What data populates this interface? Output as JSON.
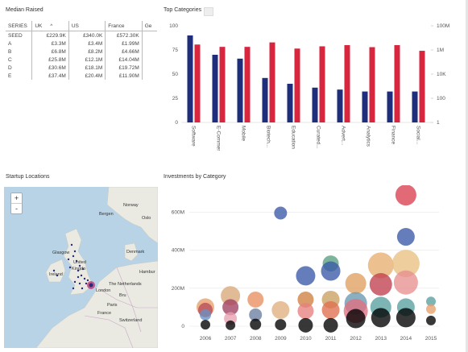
{
  "median": {
    "title": "Median Raised",
    "columns": [
      "SERIES",
      "UK",
      "US",
      "France",
      "Ge"
    ],
    "rows": [
      {
        "series": "SEED",
        "uk": "£229.9K",
        "us": "£340.0K",
        "france": "£572.30K"
      },
      {
        "series": "A",
        "uk": "£3.3M",
        "us": "£3.4M",
        "france": "£1.99M"
      },
      {
        "series": "B",
        "uk": "£6.8M",
        "us": "£8.2M",
        "france": "£4.66M"
      },
      {
        "series": "C",
        "uk": "£25.8M",
        "us": "£12.1M",
        "france": "£14.04M"
      },
      {
        "series": "D",
        "uk": "£30.6M",
        "us": "£18.1M",
        "france": "£19.72M"
      },
      {
        "series": "E",
        "uk": "£37.4M",
        "us": "£20.4M",
        "france": "£11.90M"
      }
    ],
    "sort_icon": "chevron-up-icon"
  },
  "top_categories": {
    "title": "Top Categories",
    "chart_data": {
      "type": "bar",
      "categories": [
        "Software",
        "E-Commerce",
        "Mobile",
        "Biotech...",
        "Education",
        "Curated...",
        "Advert...",
        "Analytics",
        "Finance",
        "Social..."
      ],
      "series": [
        {
          "values": [
            90,
            70,
            66,
            46,
            40,
            36,
            34,
            32,
            32,
            32
          ],
          "axis": "left",
          "color": "#1f2e7a"
        },
        {
          "values": [
            2800000,
            1800000,
            1800000,
            4200000,
            1300000,
            2000000,
            2500000,
            1700000,
            2500000,
            850000
          ],
          "axis": "right",
          "color": "#d7263d"
        }
      ],
      "y_left": {
        "ticks": [
          "0",
          "25",
          "50",
          "75",
          "100"
        ],
        "ylim": [
          0,
          100
        ]
      },
      "y_right": {
        "ticks": [
          "1",
          "100",
          "10K",
          "1M",
          "100M"
        ],
        "scale": "log",
        "ylim": [
          1,
          100000000
        ]
      }
    }
  },
  "map": {
    "title": "Startup Locations",
    "zoom_in": "+",
    "zoom_out": "-",
    "labels": [
      "Norway",
      "Oslo",
      "Bergen",
      "Glasgow",
      "Denmark",
      "United",
      "Kingdo",
      "Ireland",
      "Hambur",
      "The Netherlands",
      "London",
      "Bru",
      "Paris",
      "France",
      "Switzerland"
    ]
  },
  "investments": {
    "title": "Investments by Category",
    "chart_data": {
      "type": "scatter",
      "x_ticks": [
        "2006",
        "2007",
        "2008",
        "2009",
        "2010",
        "2011",
        "2012",
        "2013",
        "2014",
        "2015"
      ],
      "y_ticks": [
        "0",
        "200M",
        "400M",
        "600M"
      ],
      "ylim": [
        0,
        720000000
      ],
      "points": [
        {
          "x": 2006,
          "y": 100000000,
          "r": 11,
          "color": "#e8a06a"
        },
        {
          "x": 2006,
          "y": 85000000,
          "r": 9,
          "color": "#b84a5a"
        },
        {
          "x": 2006,
          "y": 60000000,
          "r": 7,
          "color": "#6c8fc0"
        },
        {
          "x": 2006,
          "y": 8000000,
          "r": 6,
          "color": "#000000"
        },
        {
          "x": 2007,
          "y": 160000000,
          "r": 12,
          "color": "#d8a878"
        },
        {
          "x": 2007,
          "y": 100000000,
          "r": 10,
          "color": "#a04060"
        },
        {
          "x": 2007,
          "y": 40000000,
          "r": 8,
          "color": "#e8a0b0"
        },
        {
          "x": 2007,
          "y": 5000000,
          "r": 6,
          "color": "#000000"
        },
        {
          "x": 2008,
          "y": 140000000,
          "r": 10,
          "color": "#e89060"
        },
        {
          "x": 2008,
          "y": 60000000,
          "r": 8,
          "color": "#6c7fa0"
        },
        {
          "x": 2008,
          "y": 10000000,
          "r": 7,
          "color": "#000000"
        },
        {
          "x": 2009,
          "y": 595000000,
          "r": 8,
          "color": "#3a5aa8"
        },
        {
          "x": 2009,
          "y": 85000000,
          "r": 11,
          "color": "#e0b080"
        },
        {
          "x": 2009,
          "y": 8000000,
          "r": 7,
          "color": "#000000"
        },
        {
          "x": 2010,
          "y": 265000000,
          "r": 12,
          "color": "#3a5aa8"
        },
        {
          "x": 2010,
          "y": 140000000,
          "r": 10,
          "color": "#d08040"
        },
        {
          "x": 2010,
          "y": 80000000,
          "r": 10,
          "color": "#e88080"
        },
        {
          "x": 2010,
          "y": 5000000,
          "r": 9,
          "color": "#000000"
        },
        {
          "x": 2011,
          "y": 330000000,
          "r": 10,
          "color": "#58a080"
        },
        {
          "x": 2011,
          "y": 290000000,
          "r": 12,
          "color": "#3a5aa8"
        },
        {
          "x": 2011,
          "y": 140000000,
          "r": 11,
          "color": "#c8a060"
        },
        {
          "x": 2011,
          "y": 85000000,
          "r": 11,
          "color": "#e07050"
        },
        {
          "x": 2011,
          "y": 5000000,
          "r": 9,
          "color": "#000000"
        },
        {
          "x": 2012,
          "y": 225000000,
          "r": 13,
          "color": "#e0a060"
        },
        {
          "x": 2012,
          "y": 120000000,
          "r": 14,
          "color": "#6898b0"
        },
        {
          "x": 2012,
          "y": 80000000,
          "r": 15,
          "color": "#e07080"
        },
        {
          "x": 2012,
          "y": 40000000,
          "r": 12,
          "color": "#000000"
        },
        {
          "x": 2013,
          "y": 320000000,
          "r": 16,
          "color": "#e8b070"
        },
        {
          "x": 2013,
          "y": 220000000,
          "r": 14,
          "color": "#c04050"
        },
        {
          "x": 2013,
          "y": 100000000,
          "r": 13,
          "color": "#58a0a0"
        },
        {
          "x": 2013,
          "y": 45000000,
          "r": 12,
          "color": "#000000"
        },
        {
          "x": 2014,
          "y": 690000000,
          "r": 13,
          "color": "#d84050"
        },
        {
          "x": 2014,
          "y": 470000000,
          "r": 11,
          "color": "#3a5aa8"
        },
        {
          "x": 2014,
          "y": 330000000,
          "r": 17,
          "color": "#e8c080"
        },
        {
          "x": 2014,
          "y": 230000000,
          "r": 15,
          "color": "#e89090"
        },
        {
          "x": 2014,
          "y": 100000000,
          "r": 11,
          "color": "#58a0a0"
        },
        {
          "x": 2014,
          "y": 45000000,
          "r": 12,
          "color": "#000000"
        },
        {
          "x": 2015,
          "y": 130000000,
          "r": 6,
          "color": "#58a0a0"
        },
        {
          "x": 2015,
          "y": 90000000,
          "r": 6,
          "color": "#e8a06a"
        },
        {
          "x": 2015,
          "y": 30000000,
          "r": 6,
          "color": "#000000"
        }
      ]
    }
  }
}
